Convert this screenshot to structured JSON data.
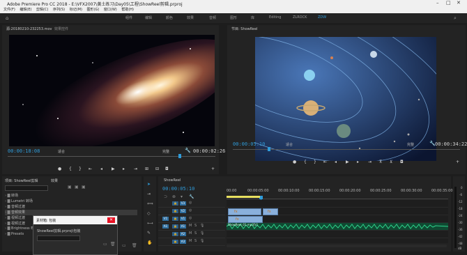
{
  "app": {
    "title": "Adobe Premiere Pro CC 2018 - E:\\VFX2007\\黄土练习\\Day05\\工程\\ShowReel剪辑.prproj"
  },
  "menu": [
    "文件(F)",
    "编辑(E)",
    "剪辑(C)",
    "序列(S)",
    "标记(M)",
    "图形(G)",
    "窗口(W)",
    "帮助(H)"
  ],
  "workspaces": [
    "组件",
    "编辑",
    "颜色",
    "效果",
    "音频",
    "图形",
    "库",
    "Editing",
    "ZLROCK",
    "ZDW"
  ],
  "source": {
    "tab1": "源:20180210-232253.mov",
    "tab2": "效果控件",
    "timecode": "00:00:18:08",
    "fit": "适合",
    "quality": "完整",
    "duration": "00:00:02:26"
  },
  "program": {
    "tab": "节目: ShowReel",
    "timecode": "00:00:05:10",
    "fit": "适合",
    "quality": "完整",
    "duration": "00:00:34:22"
  },
  "project": {
    "tab1": "项目: ShowReel剪辑",
    "tab2": "效果",
    "items": [
      "转场",
      "Lumetri 转场",
      "音频过渡",
      "音频效果",
      "视频过渡",
      "视频过渡",
      "Brightness Effects",
      "Presets"
    ]
  },
  "dialog": {
    "title": "素材箱: 包装",
    "path": "ShowReel剪辑.prproj\\包装"
  },
  "timeline": {
    "tab": "ShowReel",
    "timecode": "00:00:05:10",
    "ruler": [
      "00:00",
      "00:00:05:00",
      "00:00:10:00",
      "00:00:15:00",
      "00:00:20:00",
      "00:00:25:00",
      "00:00:30:00",
      "00:00:35:00"
    ],
    "tracks": [
      "V3",
      "V2",
      "V1",
      "A1",
      "A2",
      "A3"
    ],
    "src_v": "V1",
    "src_a": "A1",
    "clip_label": "ShowReel_01.mp3[V]"
  },
  "meter": [
    "0",
    "-6",
    "-12",
    "-18",
    "-24",
    "-30",
    "-36",
    "-42",
    "-48",
    "dB"
  ],
  "colors": {
    "accent": "#2f9bd9",
    "video_clip": "#8ab0dc",
    "audio_clip": "#1aa06a",
    "title_bar": "#f0f0f0"
  }
}
